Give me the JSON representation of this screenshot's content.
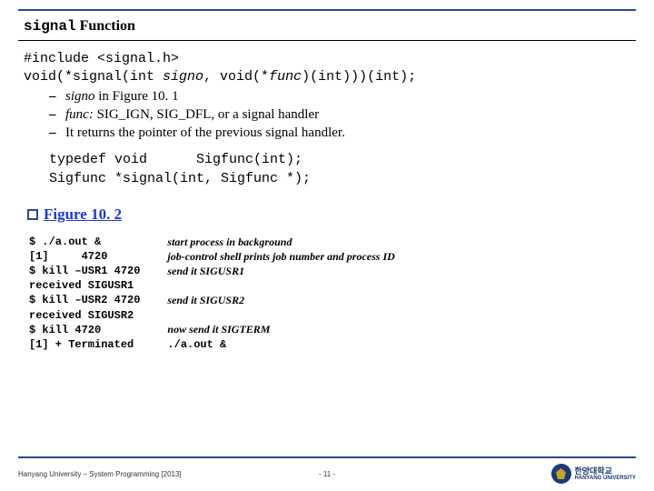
{
  "title": {
    "mono": "signal",
    "rest": " Function"
  },
  "decl": {
    "line1a": "#include <signal.h>",
    "line2a": "void(*signal(int ",
    "line2b": "signo",
    "line2c": ", void(*",
    "line2d": "func",
    "line2e": ")(int)))(int);"
  },
  "bullets": [
    {
      "pre_italic": "signo",
      "rest": " in Figure 10. 1"
    },
    {
      "pre_italic": "func:",
      "rest": " SIG_IGN, SIG_DFL, or a signal handler"
    },
    {
      "pre_italic": "",
      "rest": "It returns the pointer of the previous signal handler."
    }
  ],
  "typedef": "typedef void      Sigfunc(int);\nSigfunc *signal(int, Sigfunc *);",
  "figure_label": "Figure 10. 2",
  "term_left": "$ ./a.out &\n[1]     4720\n$ kill –USR1 4720\nreceived SIGUSR1\n$ kill –USR2 4720\nreceived SIGUSR2\n$ kill 4720\n[1] + Terminated",
  "term_right": [
    "start process in background",
    "job-control shell prints job number and process ID",
    "send it SIGUSR1",
    "",
    "send it SIGUSR2",
    "",
    "now send it SIGTERM",
    "./a.out &"
  ],
  "footer": {
    "left": "Hanyang University – System Programming [2013]",
    "center": "- 11 -",
    "logo_kr": "한양대학교",
    "logo_en": "HANYANG UNIVERSITY"
  }
}
